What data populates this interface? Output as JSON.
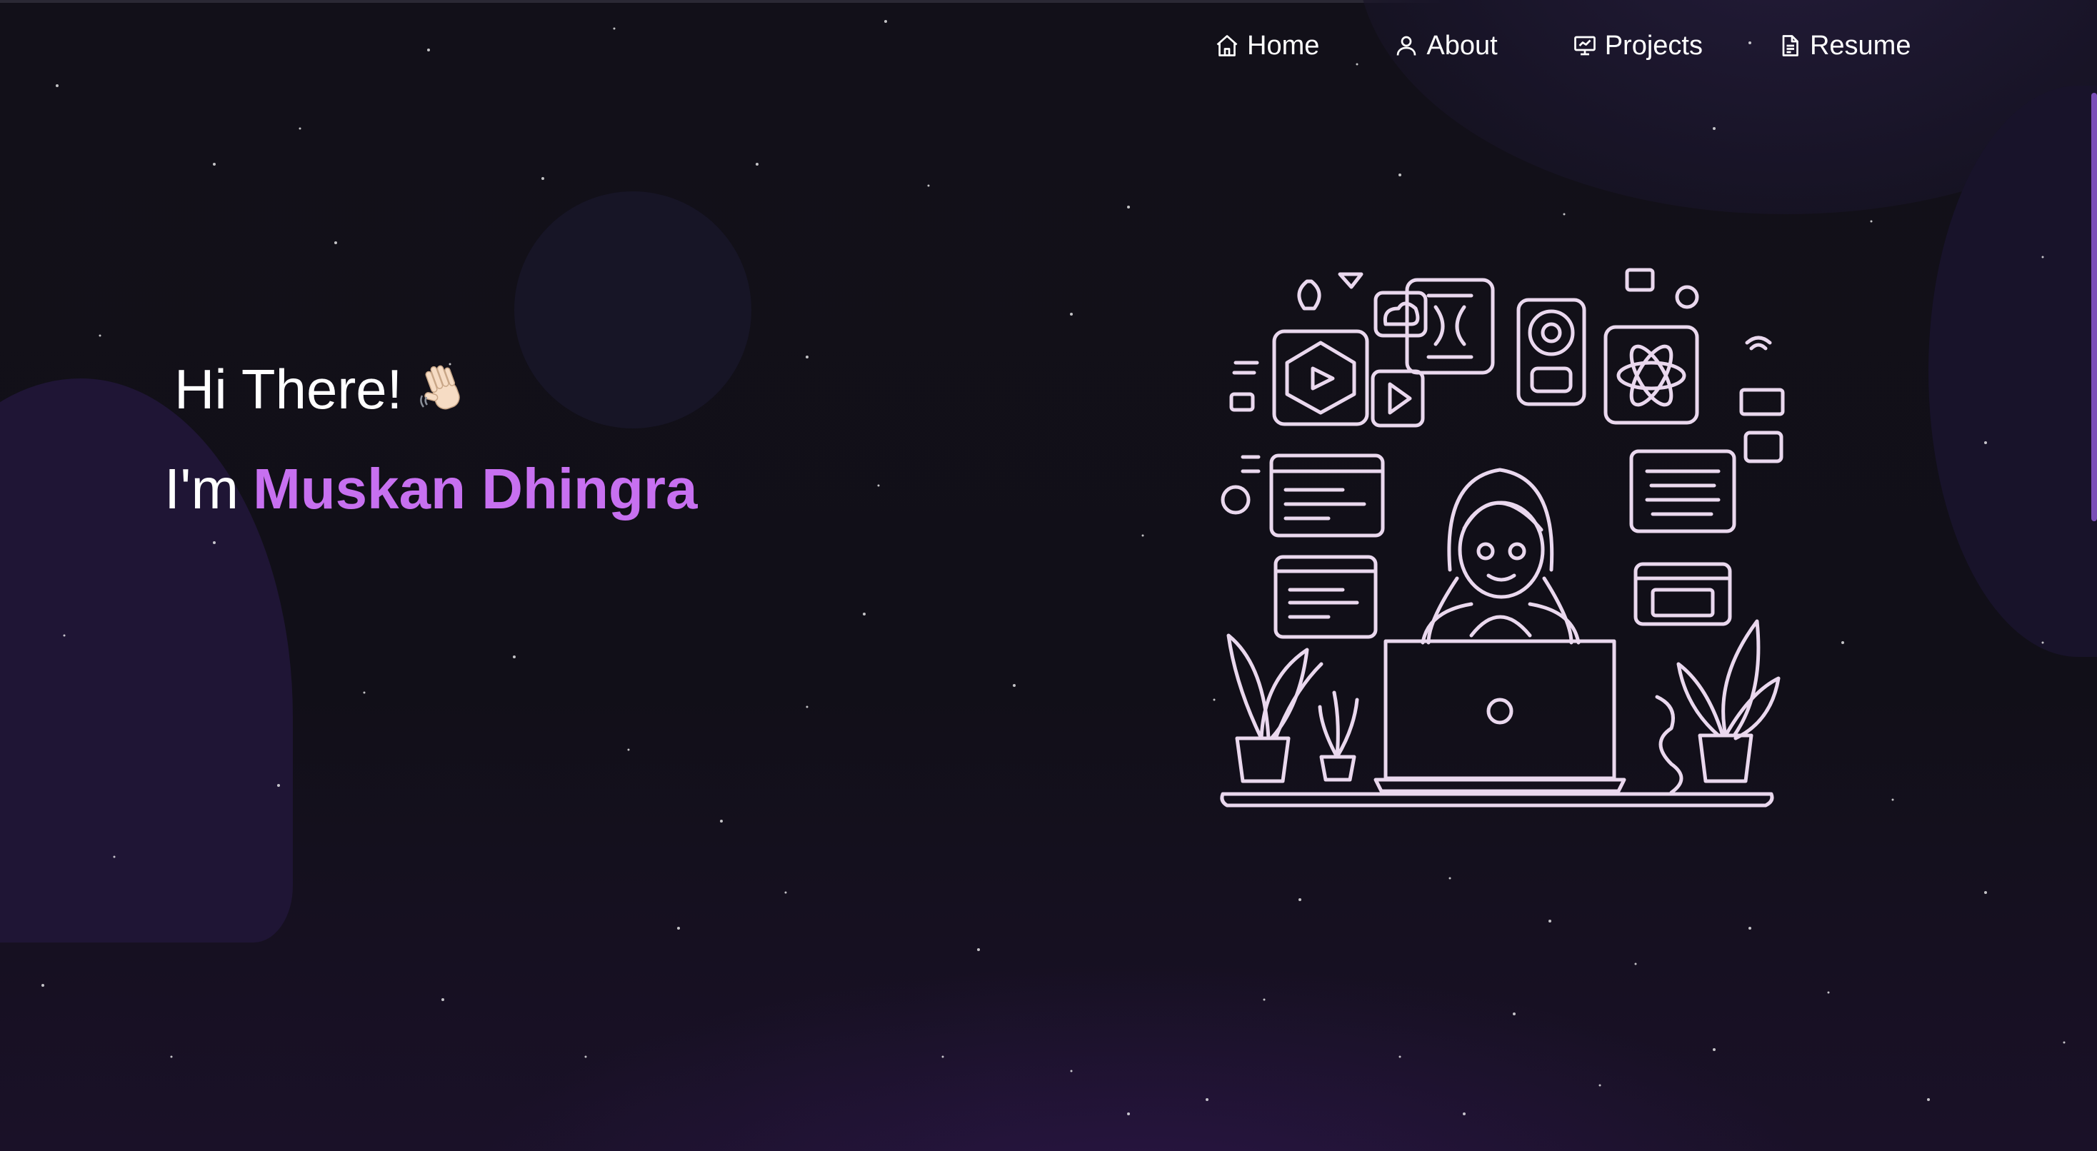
{
  "nav": {
    "items": [
      {
        "label": "Home",
        "icon": "home-icon"
      },
      {
        "label": "About",
        "icon": "user-icon"
      },
      {
        "label": "Projects",
        "icon": "projects-icon"
      },
      {
        "label": "Resume",
        "icon": "document-icon"
      }
    ]
  },
  "hero": {
    "greeting": "Hi There!",
    "greeting_emoji": "waving-hand",
    "intro_prefix": "I'm",
    "name": "Muskan Dhingra"
  },
  "colors": {
    "background": "#110f18",
    "accent": "#c770f0",
    "text": "#ffffff",
    "illustration_stroke": "#ead8ee"
  }
}
